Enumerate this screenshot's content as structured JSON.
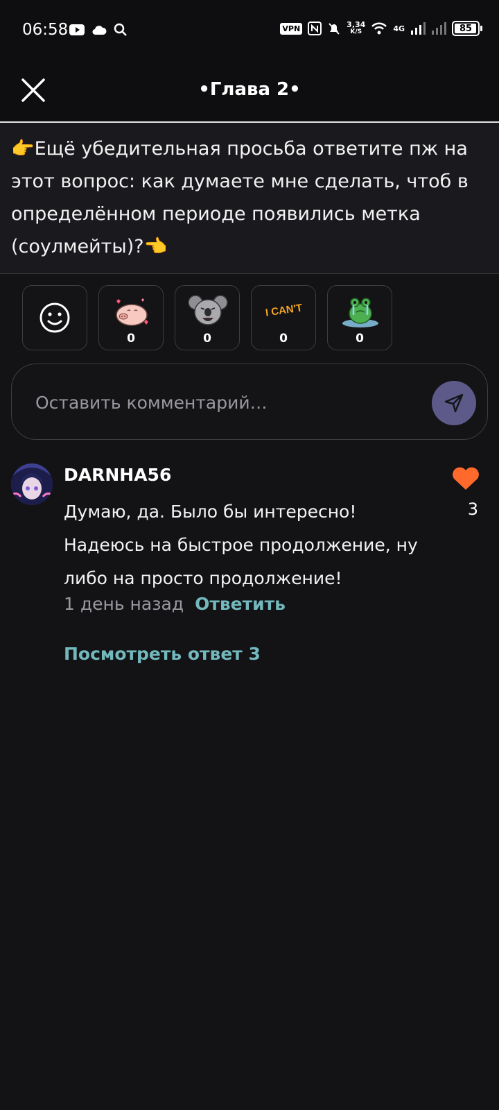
{
  "status_bar": {
    "time": "06:58",
    "left_icons": [
      "youtube-icon",
      "cloud-icon",
      "search-icon"
    ],
    "vpn_label": "VPN",
    "speed_value": "3,34",
    "speed_unit": "K/S",
    "network": "4G",
    "battery": "85"
  },
  "header": {
    "title": "•Глава 2•",
    "close_icon": "close-icon"
  },
  "notice": {
    "text": "👉Ещё убедительная просьба  ответите пж на этот вопрос: как думаете мне сделать, чтоб в определённом периоде появились метка (соулмейты)?👈"
  },
  "reactions": [
    {
      "icon": "emoji-smile-icon",
      "count": null
    },
    {
      "icon": "pig-hearts-sticker",
      "count": "0"
    },
    {
      "icon": "koala-laugh-sticker",
      "count": "0"
    },
    {
      "icon": "i-cant-sticker",
      "count": "0"
    },
    {
      "icon": "frog-crying-sticker",
      "count": "0"
    }
  ],
  "sticker_text": "I CAN'T",
  "comment_box": {
    "placeholder": "Оставить комментарий…",
    "send_icon": "send-icon"
  },
  "comment": {
    "author": "DARNHA56",
    "text": "Думаю, да. Было бы интересно! Надеюсь на быстрое продолжение, ну либо на просто продолжение!",
    "time": "1 день назад",
    "reply_label": "Ответить",
    "like_count": "3",
    "view_replies": "Посмотреть ответ 3"
  },
  "colors": {
    "background": "#131215",
    "accent_teal": "#73b8bd",
    "like_orange": "#ff6a2c",
    "send_bg": "#5d5a8a"
  }
}
